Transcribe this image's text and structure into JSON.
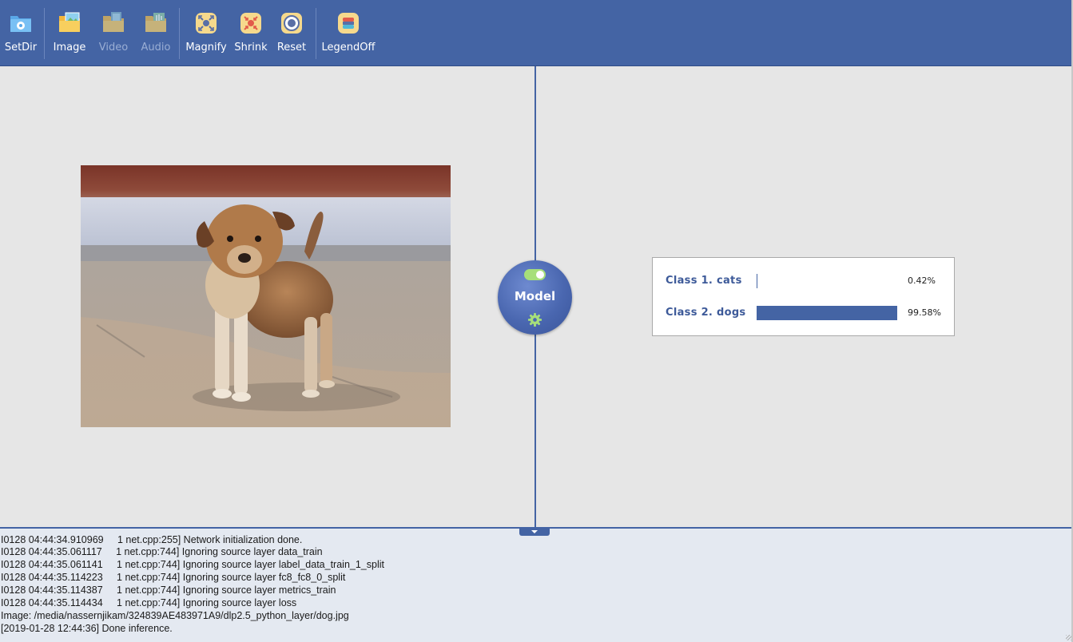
{
  "toolbar": {
    "items": [
      {
        "label": "SetDir",
        "icon": "folder-gear-icon",
        "enabled": true
      },
      {
        "label": "Image",
        "icon": "folder-image-icon",
        "enabled": true
      },
      {
        "label": "Video",
        "icon": "folder-video-icon",
        "enabled": false
      },
      {
        "label": "Audio",
        "icon": "folder-audio-icon",
        "enabled": false
      },
      {
        "label": "Magnify",
        "icon": "magnify-icon",
        "enabled": true
      },
      {
        "label": "Shrink",
        "icon": "shrink-icon",
        "enabled": true
      },
      {
        "label": "Reset",
        "icon": "reset-icon",
        "enabled": true
      },
      {
        "label": "LegendOff",
        "icon": "legend-icon",
        "enabled": true
      }
    ]
  },
  "model": {
    "label": "Model",
    "toggle_on": true
  },
  "results": [
    {
      "name": "Class 1. cats",
      "percent_text": "0.42%",
      "fraction": 0.0042
    },
    {
      "name": "Class 2. dogs",
      "percent_text": "99.58%",
      "fraction": 0.9958
    }
  ],
  "log": {
    "lines": [
      "I0128 04:44:34.910969     1 net.cpp:255] Network initialization done.",
      "I0128 04:44:35.061117     1 net.cpp:744] Ignoring source layer data_train",
      "I0128 04:44:35.061141     1 net.cpp:744] Ignoring source layer label_data_train_1_split",
      "I0128 04:44:35.114223     1 net.cpp:744] Ignoring source layer fc8_fc8_0_split",
      "I0128 04:44:35.114387     1 net.cpp:744] Ignoring source layer metrics_train",
      "I0128 04:44:35.114434     1 net.cpp:744] Ignoring source layer loss",
      "Image: /media/nassernjikam/324839AE483971A9/dlp2.5_python_layer/dog.jpg",
      "[2019-01-28 12:44:36] Done inference."
    ]
  },
  "colors": {
    "toolbar_bg": "#4464a4",
    "accent": "#4464a4",
    "label_blue": "#3d5a99",
    "toggle_green": "#a6df7a"
  }
}
